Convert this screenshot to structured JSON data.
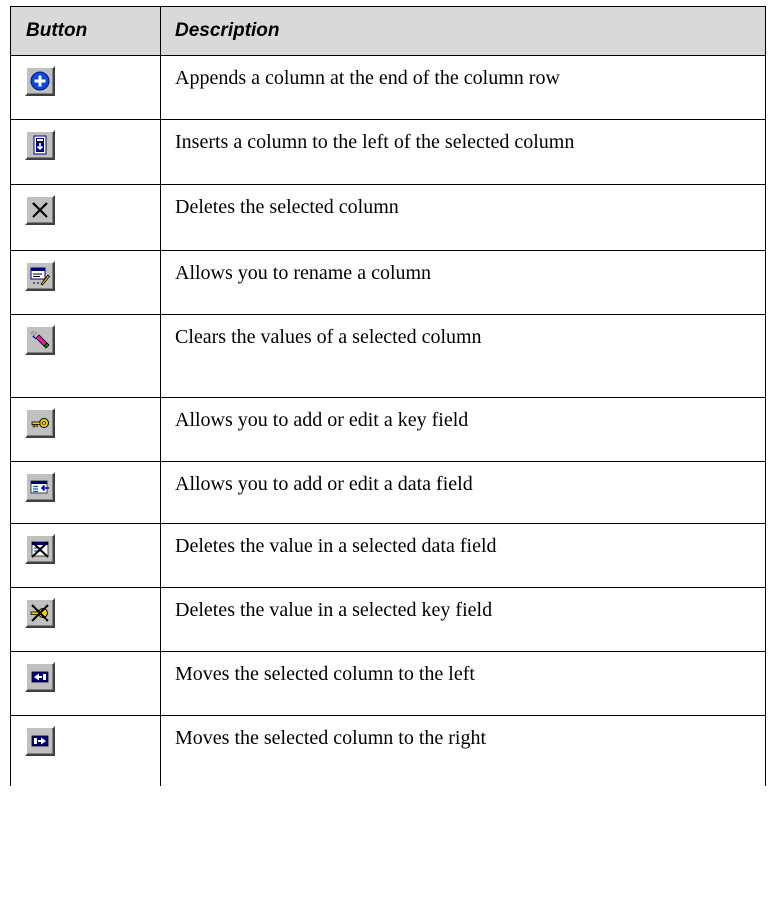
{
  "table": {
    "header": {
      "button": "Button",
      "description": "Description"
    },
    "rows": [
      {
        "icon": "add-column-icon",
        "description": "Appends a column at the end of the column row"
      },
      {
        "icon": "insert-column-icon",
        "description": "Inserts a column to the left of the selected column"
      },
      {
        "icon": "delete-column-icon",
        "description": "Deletes the selected column"
      },
      {
        "icon": "rename-column-icon",
        "description": "Allows you to rename a column"
      },
      {
        "icon": "clear-values-icon",
        "description": "Clears the values of a selected column"
      },
      {
        "icon": "key-field-icon",
        "description": "Allows you to add or edit a key field"
      },
      {
        "icon": "data-field-icon",
        "description": "Allows you to add or edit a data field"
      },
      {
        "icon": "delete-data-field-icon",
        "description": "Deletes the value in a selected data field"
      },
      {
        "icon": "delete-key-field-icon",
        "description": "Deletes the value in a selected key field"
      },
      {
        "icon": "move-left-icon",
        "description": "Moves the selected column to the left"
      },
      {
        "icon": "move-right-icon",
        "description": "Moves the selected column to the right"
      }
    ]
  }
}
